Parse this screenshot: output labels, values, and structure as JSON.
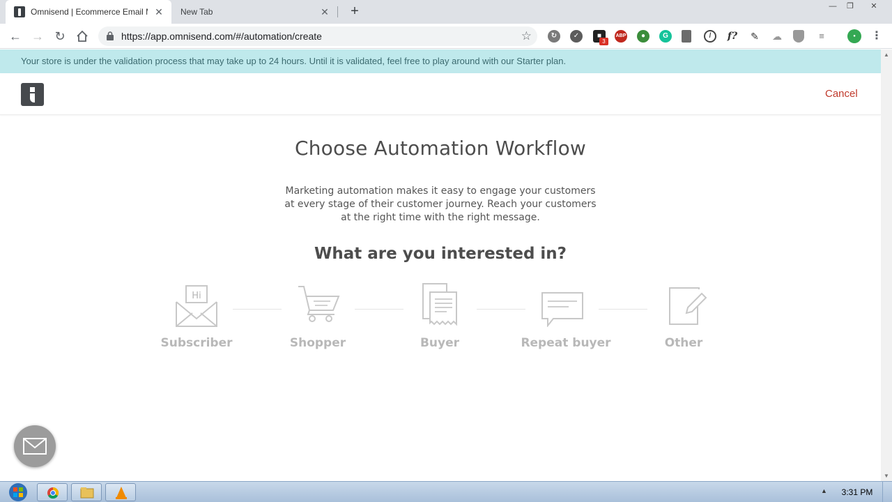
{
  "browser": {
    "tabs": [
      {
        "title": "Omnisend | Ecommerce Email M",
        "active": true
      },
      {
        "title": "New Tab",
        "active": false
      }
    ],
    "url": "https://app.omnisend.com/#/automation/create",
    "extension_badge": "3",
    "extension_icons": [
      "sync-icon",
      "circle-check-icon",
      "notes-icon",
      "adblock-icon",
      "globe-icon",
      "grammarly-icon",
      "bookmark-icon",
      "no-icon",
      "formula-icon",
      "pen-icon",
      "cloud-icon",
      "shield-icon",
      "list-icon",
      "profile-icon"
    ]
  },
  "banner": {
    "text": "Your store is under the validation process that may take up to 24 hours. Until it is validated, feel free to play around with our Starter plan."
  },
  "header": {
    "cancel_label": "Cancel"
  },
  "main": {
    "heading": "Choose Automation Workflow",
    "description": "Marketing automation makes it easy to engage your customers at every stage of their customer journey. Reach your customers at the right time with the right message.",
    "subheading": "What are you interested in?",
    "options": [
      {
        "label": "Subscriber",
        "icon": "envelope-hi-icon"
      },
      {
        "label": "Shopper",
        "icon": "cart-icon"
      },
      {
        "label": "Buyer",
        "icon": "receipt-icon"
      },
      {
        "label": "Repeat buyer",
        "icon": "chat-bubble-icon"
      },
      {
        "label": "Other",
        "icon": "edit-page-icon"
      }
    ],
    "envelope_text": "Hi"
  },
  "taskbar": {
    "clock": "3:31 PM"
  },
  "colors": {
    "banner_bg": "#bfe9ec",
    "accent_red": "#c0392b",
    "option_gray": "#b8b8b8"
  }
}
